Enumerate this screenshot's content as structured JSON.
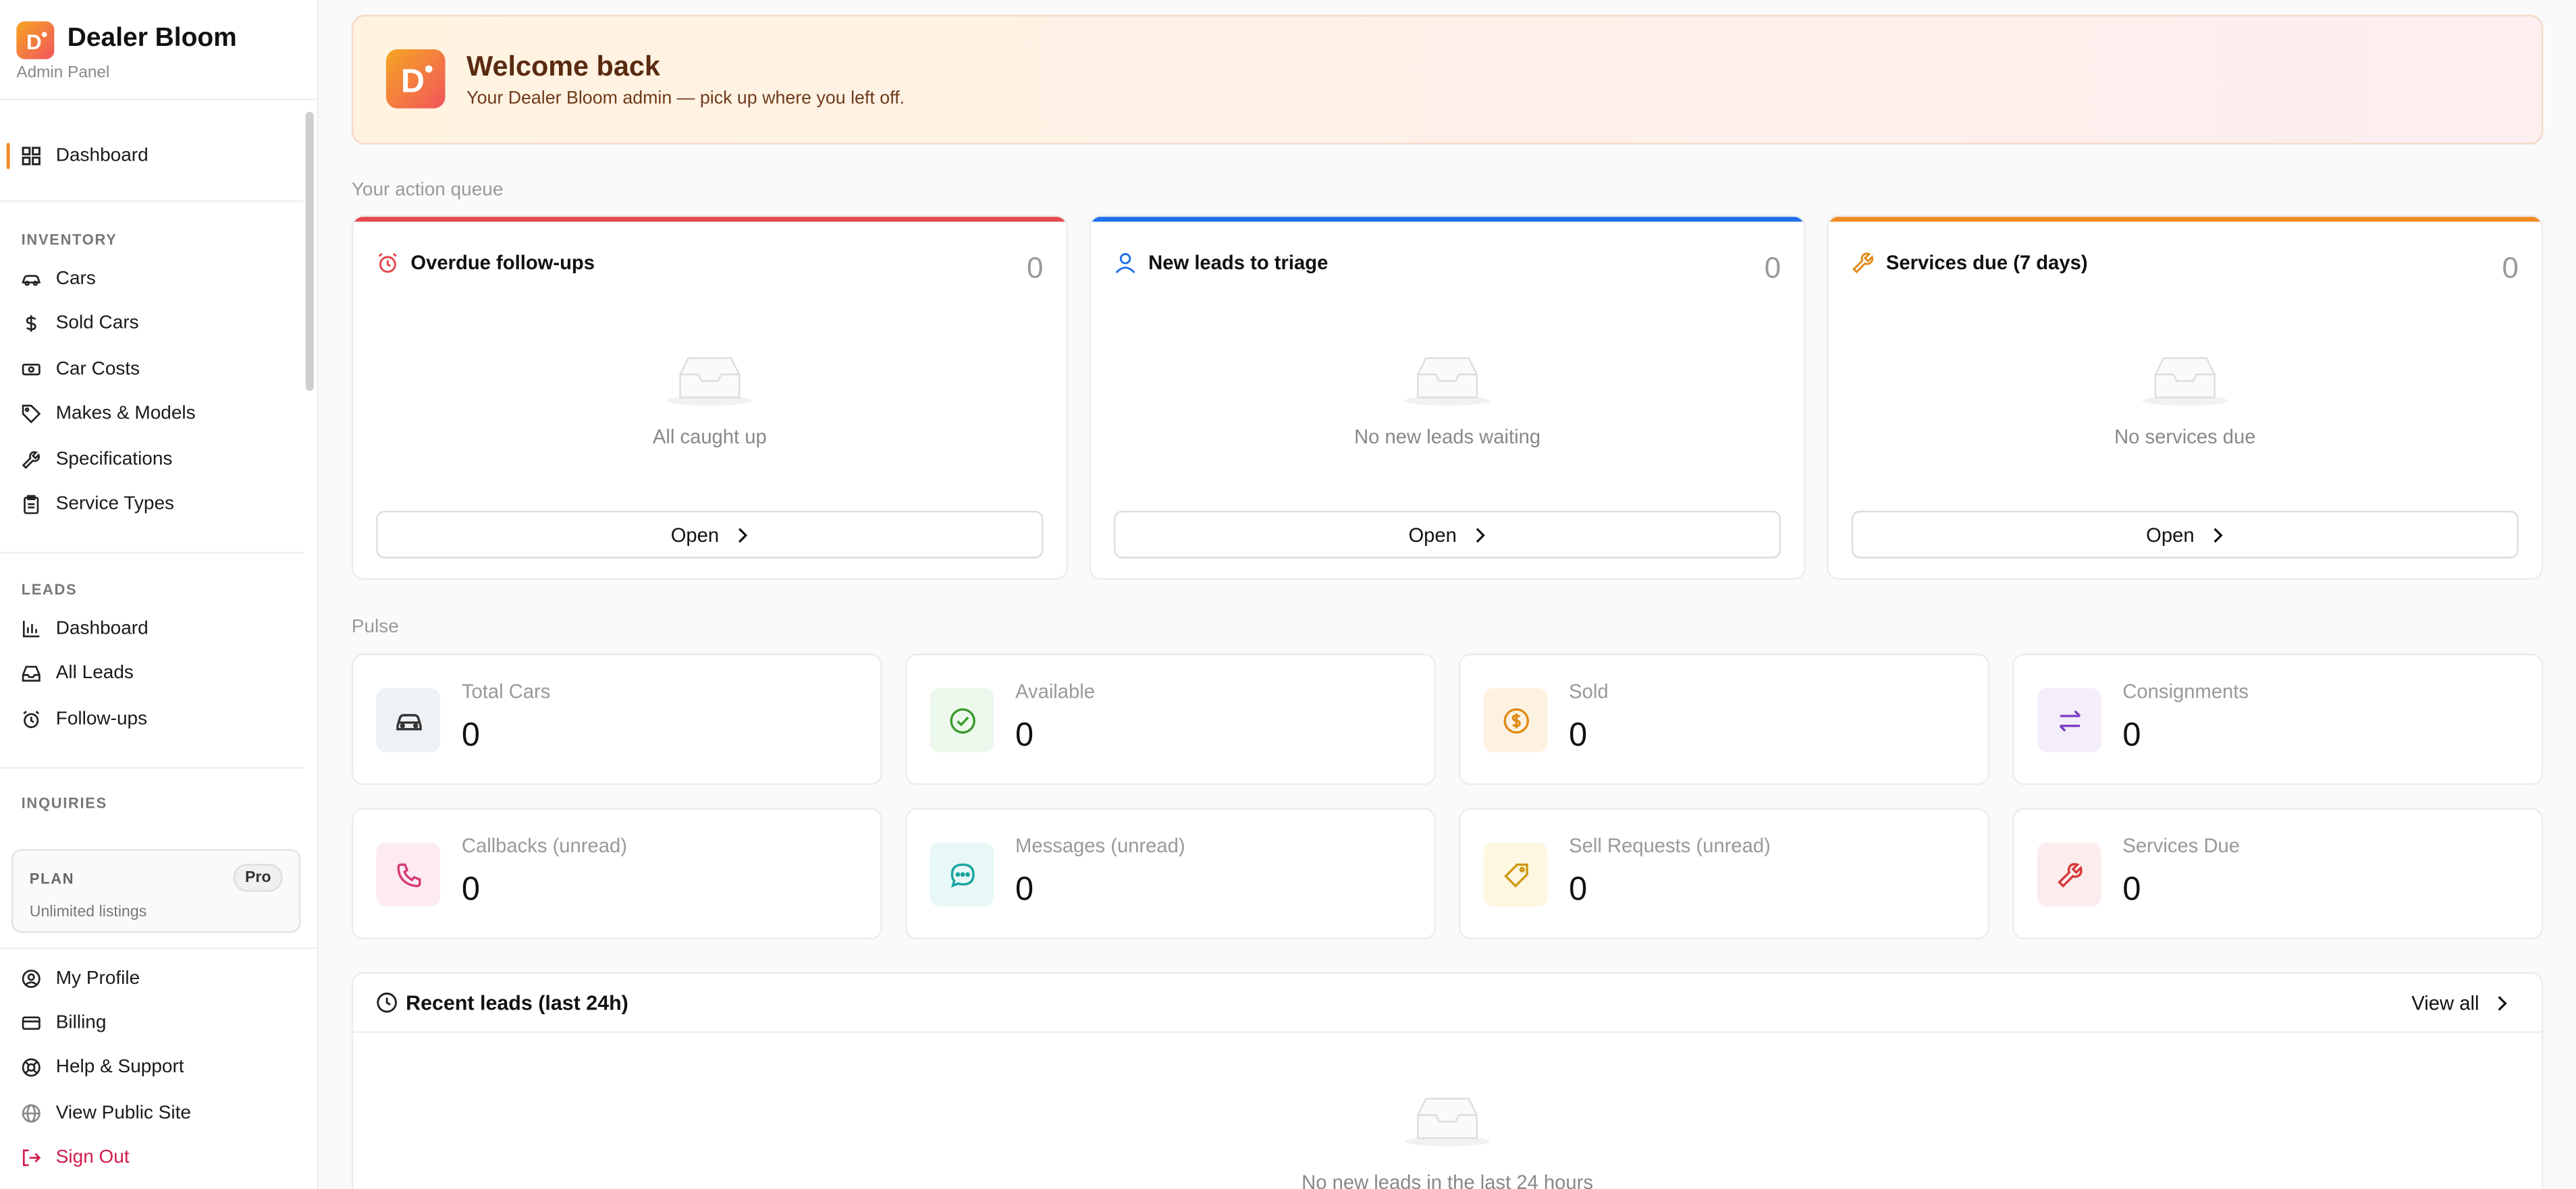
{
  "brand": {
    "name": "Dealer Bloom",
    "subtitle": "Admin Panel",
    "logo_letter": "D"
  },
  "sidebar": {
    "primary": {
      "label": "Dashboard",
      "icon": "grid-icon"
    },
    "sections": [
      {
        "title": "INVENTORY",
        "items": [
          {
            "label": "Cars",
            "icon": "car-icon"
          },
          {
            "label": "Sold Cars",
            "icon": "dollar-icon"
          },
          {
            "label": "Car Costs",
            "icon": "money-icon"
          },
          {
            "label": "Makes & Models",
            "icon": "tag-icon"
          },
          {
            "label": "Specifications",
            "icon": "wrench-icon"
          },
          {
            "label": "Service Types",
            "icon": "clipboard-icon"
          }
        ]
      },
      {
        "title": "LEADS",
        "items": [
          {
            "label": "Dashboard",
            "icon": "bar-chart-icon"
          },
          {
            "label": "All Leads",
            "icon": "inbox-icon"
          },
          {
            "label": "Follow-ups",
            "icon": "alarm-icon"
          }
        ]
      },
      {
        "title": "INQUIRIES",
        "items": []
      }
    ],
    "plan": {
      "title": "PLAN",
      "badge": "Pro",
      "subtitle": "Unlimited listings"
    },
    "footer": [
      {
        "label": "My Profile",
        "icon": "user-circle-icon"
      },
      {
        "label": "Billing",
        "icon": "credit-card-icon"
      },
      {
        "label": "Help & Support",
        "icon": "lifebuoy-icon"
      },
      {
        "label": "View Public Site",
        "icon": "globe-icon"
      },
      {
        "label": "Sign Out",
        "icon": "logout-icon"
      }
    ]
  },
  "welcome": {
    "title": "Welcome back",
    "subtitle": "Your Dealer Bloom admin — pick up where you left off."
  },
  "queue": {
    "label": "Your action queue",
    "cards": [
      {
        "title": "Overdue follow-ups",
        "count": "0",
        "empty": "All caught up",
        "button": "Open",
        "accent": "#e5484d",
        "icon": "alarm-icon"
      },
      {
        "title": "New leads to triage",
        "count": "0",
        "empty": "No new leads waiting",
        "button": "Open",
        "accent": "#1f6feb",
        "icon": "user-icon"
      },
      {
        "title": "Services due (7 days)",
        "count": "0",
        "empty": "No services due",
        "button": "Open",
        "accent": "#f08a24",
        "icon": "wrench-icon"
      }
    ]
  },
  "pulse": {
    "label": "Pulse",
    "stats": [
      {
        "label": "Total Cars",
        "value": "0",
        "icon": "car-icon",
        "bg": "#eef2f5",
        "fg": "#333"
      },
      {
        "label": "Available",
        "value": "0",
        "icon": "check-circle-icon",
        "bg": "#edf8ec",
        "fg": "#3a9a2c"
      },
      {
        "label": "Sold",
        "value": "0",
        "icon": "dollar-circle-icon",
        "bg": "#fdf2e2",
        "fg": "#e08a14"
      },
      {
        "label": "Consignments",
        "value": "0",
        "icon": "swap-icon",
        "bg": "#f4eefb",
        "fg": "#7a3fc4"
      },
      {
        "label": "Callbacks (unread)",
        "value": "0",
        "icon": "phone-icon",
        "bg": "#fdebf1",
        "fg": "#d63a76"
      },
      {
        "label": "Messages (unread)",
        "value": "0",
        "icon": "message-icon",
        "bg": "#e7f8f7",
        "fg": "#1aa3a0"
      },
      {
        "label": "Sell Requests (unread)",
        "value": "0",
        "icon": "tag-icon",
        "bg": "#fdf6e1",
        "fg": "#cf9a12"
      },
      {
        "label": "Services Due",
        "value": "0",
        "icon": "wrench-icon",
        "bg": "#fdeced",
        "fg": "#d33a3a"
      }
    ]
  },
  "recent": {
    "title": "Recent leads (last 24h)",
    "view_all": "View all",
    "empty": "No new leads in the last 24 hours"
  }
}
